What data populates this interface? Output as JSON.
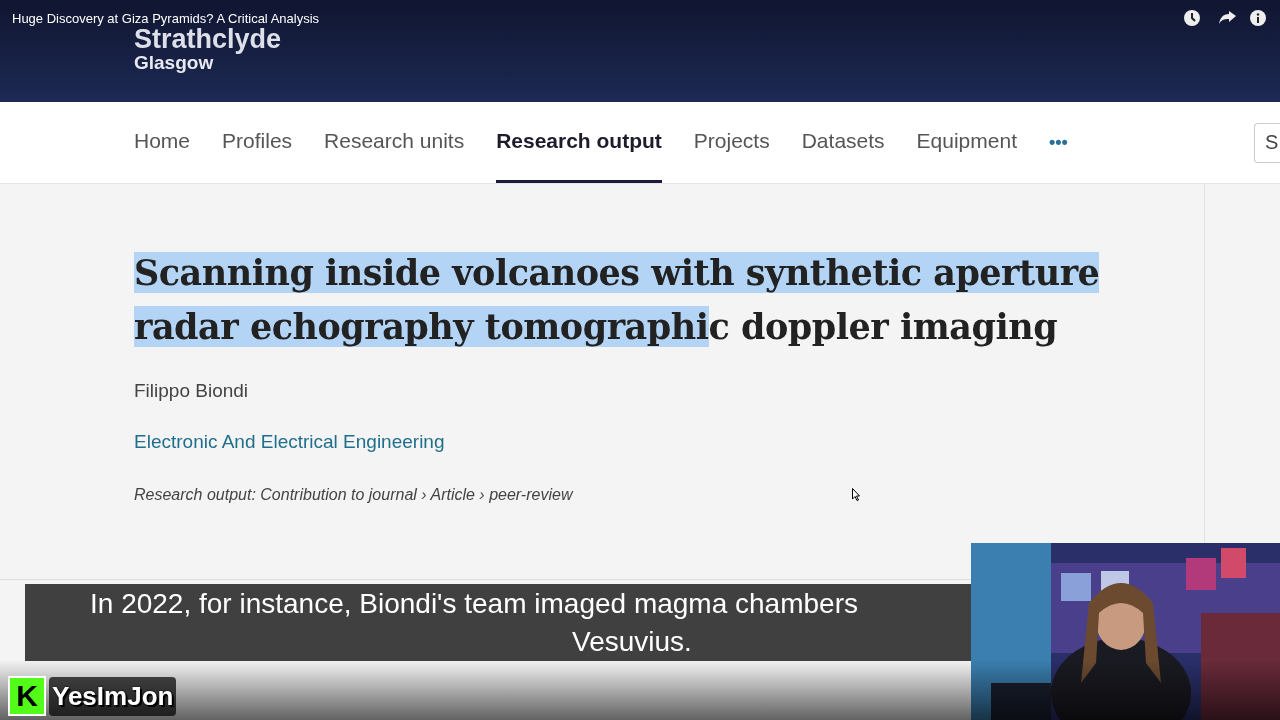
{
  "video_title": "Huge Discovery at Giza Pyramids? A Critical Analysis",
  "site": {
    "logo_lines": [
      "Strathclyde",
      "Glasgow"
    ]
  },
  "nav": {
    "items": [
      {
        "label": "Home",
        "selected": false
      },
      {
        "label": "Profiles",
        "selected": false
      },
      {
        "label": "Research units",
        "selected": false
      },
      {
        "label": "Research output",
        "selected": true
      },
      {
        "label": "Projects",
        "selected": false
      },
      {
        "label": "Datasets",
        "selected": false
      },
      {
        "label": "Equipment",
        "selected": false
      }
    ],
    "more": "•••",
    "search_placeholder": "S"
  },
  "article": {
    "title_selected": "Scanning inside volcanoes with synthetic aperture radar echography tomographi",
    "title_rest": "c doppler imaging",
    "author": "Filippo Biondi",
    "department": "Electronic And Electrical Engineering",
    "type_line": "Research output: Contribution to journal › Article › peer-review"
  },
  "caption": {
    "lines": [
      "In 2022, for instance, Biondi's team imaged magma chambers",
      "Vesuvius."
    ]
  },
  "channel": {
    "badge": "K",
    "name": "YesImJon"
  }
}
